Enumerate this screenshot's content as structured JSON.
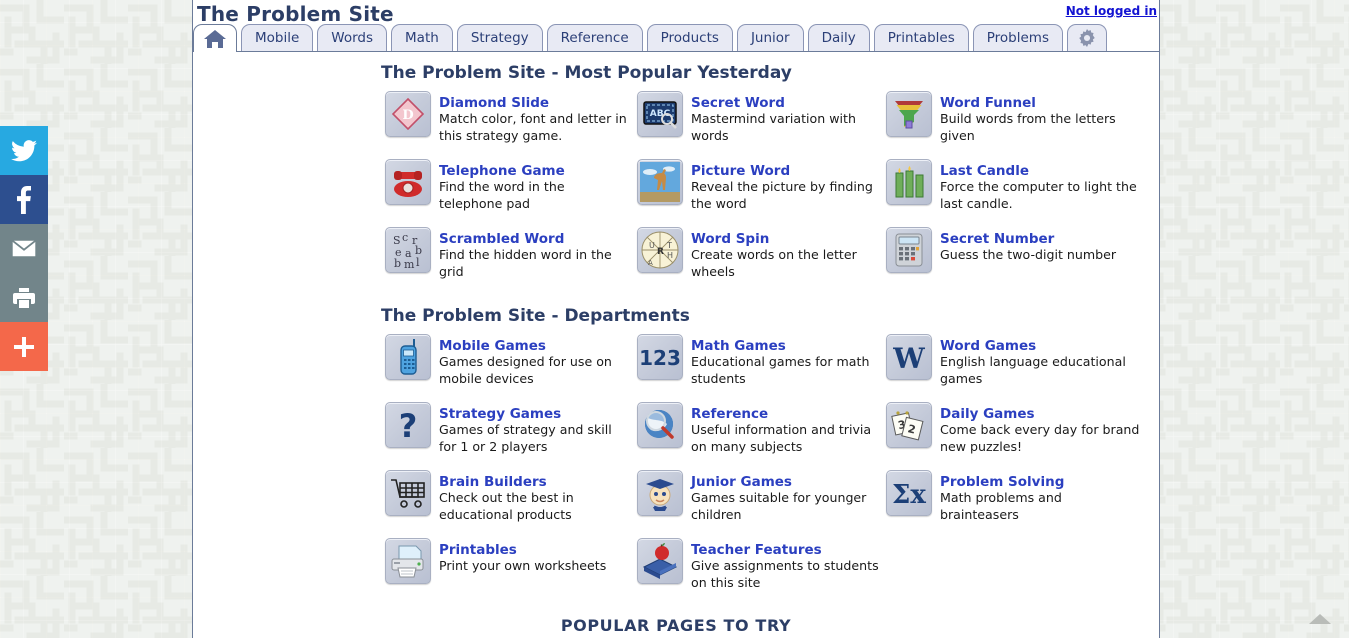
{
  "site": {
    "title": "The Problem Site",
    "login_status": "Not logged in"
  },
  "tabs": [
    {
      "label": "",
      "icon": "home-icon",
      "active": true,
      "name": "tab-home"
    },
    {
      "label": "Mobile",
      "icon": "",
      "active": false,
      "name": "tab-mobile"
    },
    {
      "label": "Words",
      "icon": "",
      "active": false,
      "name": "tab-words"
    },
    {
      "label": "Math",
      "icon": "",
      "active": false,
      "name": "tab-math"
    },
    {
      "label": "Strategy",
      "icon": "",
      "active": false,
      "name": "tab-strategy"
    },
    {
      "label": "Reference",
      "icon": "",
      "active": false,
      "name": "tab-reference"
    },
    {
      "label": "Products",
      "icon": "",
      "active": false,
      "name": "tab-products"
    },
    {
      "label": "Junior",
      "icon": "",
      "active": false,
      "name": "tab-junior"
    },
    {
      "label": "Daily",
      "icon": "",
      "active": false,
      "name": "tab-daily"
    },
    {
      "label": "Printables",
      "icon": "",
      "active": false,
      "name": "tab-printables"
    },
    {
      "label": "Problems",
      "icon": "",
      "active": false,
      "name": "tab-problems"
    },
    {
      "label": "",
      "icon": "gear-icon",
      "active": false,
      "name": "tab-settings"
    }
  ],
  "social": [
    {
      "name": "twitter-share-button",
      "icon": "twitter-icon",
      "color": "#27a9e1"
    },
    {
      "name": "facebook-share-button",
      "icon": "facebook-icon",
      "color": "#2d4f8f"
    },
    {
      "name": "email-share-button",
      "icon": "envelope-icon",
      "color": "#72858a"
    },
    {
      "name": "print-button",
      "icon": "printer-icon",
      "color": "#72858a"
    },
    {
      "name": "more-share-button",
      "icon": "plus-icon",
      "color": "#f4684a"
    }
  ],
  "sections": [
    {
      "heading": "The Problem Site - Most Popular Yesterday",
      "items": [
        {
          "title": "Diamond Slide",
          "desc": "Match color, font and letter in this strategy game.",
          "icon": "diamond-slide-icon"
        },
        {
          "title": "Secret Word",
          "desc": "Mastermind variation with words",
          "icon": "secret-word-icon"
        },
        {
          "title": "Word Funnel",
          "desc": "Build words from the letters given",
          "icon": "word-funnel-icon"
        },
        {
          "title": "Telephone Game",
          "desc": "Find the word in the telephone pad",
          "icon": "telephone-icon"
        },
        {
          "title": "Picture Word",
          "desc": "Reveal the picture by finding the word",
          "icon": "picture-word-icon"
        },
        {
          "title": "Last Candle",
          "desc": "Force the computer to light the last candle.",
          "icon": "candles-icon"
        },
        {
          "title": "Scrambled Word",
          "desc": "Find the hidden word in the grid",
          "icon": "scrambled-word-icon"
        },
        {
          "title": "Word Spin",
          "desc": "Create words on the letter wheels",
          "icon": "word-spin-icon"
        },
        {
          "title": "Secret Number",
          "desc": "Guess the two-digit number",
          "icon": "calculator-icon"
        }
      ]
    },
    {
      "heading": "The Problem Site - Departments",
      "items": [
        {
          "title": "Mobile Games",
          "desc": "Games designed for use on mobile devices",
          "icon": "mobile-phone-icon"
        },
        {
          "title": "Math Games",
          "desc": "Educational games for math students",
          "icon": "123-icon"
        },
        {
          "title": "Word Games",
          "desc": "English language educational games",
          "icon": "letter-w-icon"
        },
        {
          "title": "Strategy Games",
          "desc": "Games of strategy and skill for 1 or 2 players",
          "icon": "question-mark-icon"
        },
        {
          "title": "Reference",
          "desc": "Useful information and trivia on many subjects",
          "icon": "globe-magnifier-icon"
        },
        {
          "title": "Daily Games",
          "desc": "Come back every day for brand new puzzles!",
          "icon": "calendar-icon"
        },
        {
          "title": "Brain Builders",
          "desc": "Check out the best in educational products",
          "icon": "shopping-cart-icon"
        },
        {
          "title": "Junior Games",
          "desc": "Games suitable for younger children",
          "icon": "graduate-kid-icon"
        },
        {
          "title": "Problem Solving",
          "desc": "Math problems and brainteasers",
          "icon": "sigma-x-icon"
        },
        {
          "title": "Printables",
          "desc": "Print your own worksheets",
          "icon": "printer-doc-icon"
        },
        {
          "title": "Teacher Features",
          "desc": "Give assignments to students on this site",
          "icon": "apple-book-icon"
        },
        {
          "title": "",
          "desc": "",
          "icon": ""
        }
      ]
    }
  ],
  "footer": {
    "popular_pages_heading": "POPULAR PAGES TO TRY"
  },
  "colors": {
    "heading": "#2c3e66",
    "link": "#2b3fc0",
    "login_link": "#1414d2",
    "tab_bg": "#e8eaf4",
    "page_border": "#6b7b99"
  }
}
